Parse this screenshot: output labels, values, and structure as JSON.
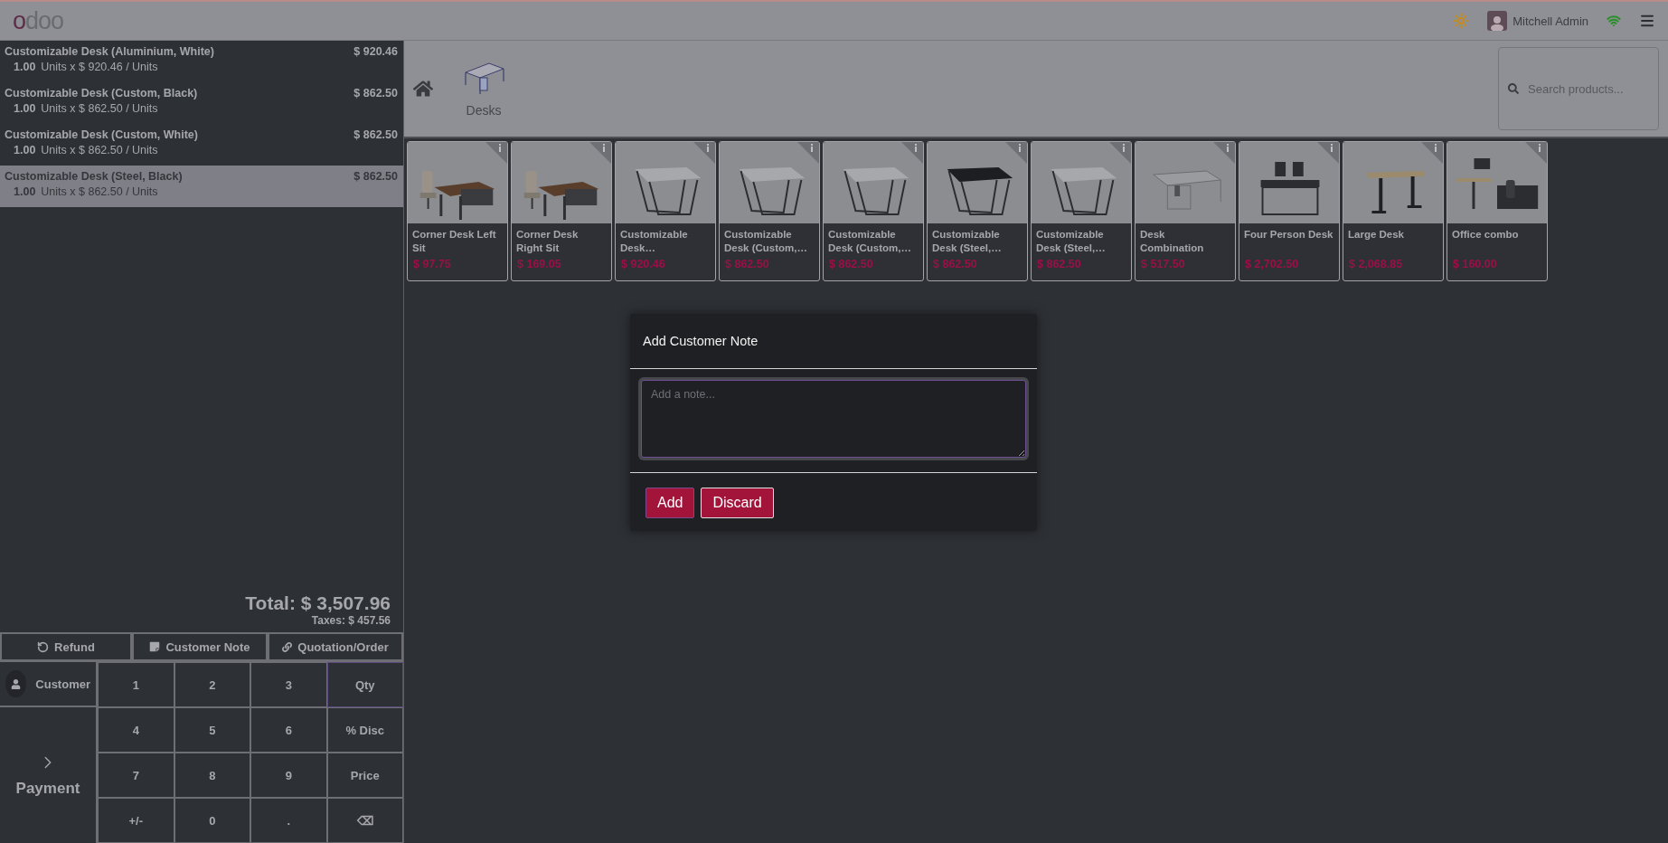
{
  "header": {
    "logo": "odoo",
    "user": "Mitchell Admin"
  },
  "order_lines": [
    {
      "name": "Customizable Desk (Aluminium, White)",
      "price": "$ 920.46",
      "quantity": "1.00",
      "detail": "Units x $ 920.46 / Units",
      "selected": false
    },
    {
      "name": "Customizable Desk (Custom, Black)",
      "price": "$ 862.50",
      "quantity": "1.00",
      "detail": "Units x $ 862.50 / Units",
      "selected": false
    },
    {
      "name": "Customizable Desk (Custom, White)",
      "price": "$ 862.50",
      "quantity": "1.00",
      "detail": "Units x $ 862.50 / Units",
      "selected": false
    },
    {
      "name": "Customizable Desk (Steel, Black)",
      "price": "$ 862.50",
      "quantity": "1.00",
      "detail": "Units x $ 862.50 / Units",
      "selected": true
    }
  ],
  "total": "Total: $ 3,507.96",
  "taxes": "Taxes: $ 457.56",
  "control_buttons": [
    {
      "kind": "refund",
      "label": "Refund"
    },
    {
      "kind": "note",
      "label": "Customer Note"
    },
    {
      "kind": "quotation",
      "label": "Quotation/Order"
    }
  ],
  "customer_button": "Customer",
  "payment_button": "Payment",
  "numpad": [
    {
      "label": "1",
      "selected": false
    },
    {
      "label": "2",
      "selected": false
    },
    {
      "label": "3",
      "selected": false
    },
    {
      "label": "Qty",
      "selected": true
    },
    {
      "label": "4",
      "selected": false
    },
    {
      "label": "5",
      "selected": false
    },
    {
      "label": "6",
      "selected": false
    },
    {
      "label": "% Disc",
      "selected": false
    },
    {
      "label": "7",
      "selected": false
    },
    {
      "label": "8",
      "selected": false
    },
    {
      "label": "9",
      "selected": false
    },
    {
      "label": "Price",
      "selected": false
    },
    {
      "label": "+/-",
      "selected": false
    },
    {
      "label": "0",
      "selected": false
    },
    {
      "label": ".",
      "selected": false
    },
    {
      "label": "⌫",
      "selected": false
    }
  ],
  "category": {
    "label": "Desks"
  },
  "search": {
    "placeholder": "Search products..."
  },
  "products": [
    {
      "name": "Corner Desk Left Sit",
      "price": "$ 97.75",
      "kind": "corner"
    },
    {
      "name": "Corner Desk Right Sit",
      "price": "$ 169.05",
      "kind": "corner"
    },
    {
      "name": "Customizable Desk…",
      "price": "$ 920.46",
      "kind": "table"
    },
    {
      "name": "Customizable Desk (Custom,…",
      "price": "$ 862.50",
      "kind": "table"
    },
    {
      "name": "Customizable Desk (Custom,…",
      "price": "$ 862.50",
      "kind": "table"
    },
    {
      "name": "Customizable Desk (Steel,…",
      "price": "$ 862.50",
      "kind": "darktable"
    },
    {
      "name": "Customizable Desk (Steel,…",
      "price": "$ 862.50",
      "kind": "table"
    },
    {
      "name": "Desk Combination",
      "price": "$ 517.50",
      "kind": "frame"
    },
    {
      "name": "Four Person Desk",
      "price": "$ 2,702.50",
      "kind": "bench"
    },
    {
      "name": "Large Desk",
      "price": "$ 2,068.85",
      "kind": "standing"
    },
    {
      "name": "Office combo",
      "price": "$ 160.00",
      "kind": "combo"
    }
  ],
  "dialog": {
    "title": "Add Customer Note",
    "placeholder": "Add a note...",
    "buttons": [
      "Add",
      "Discard"
    ]
  }
}
